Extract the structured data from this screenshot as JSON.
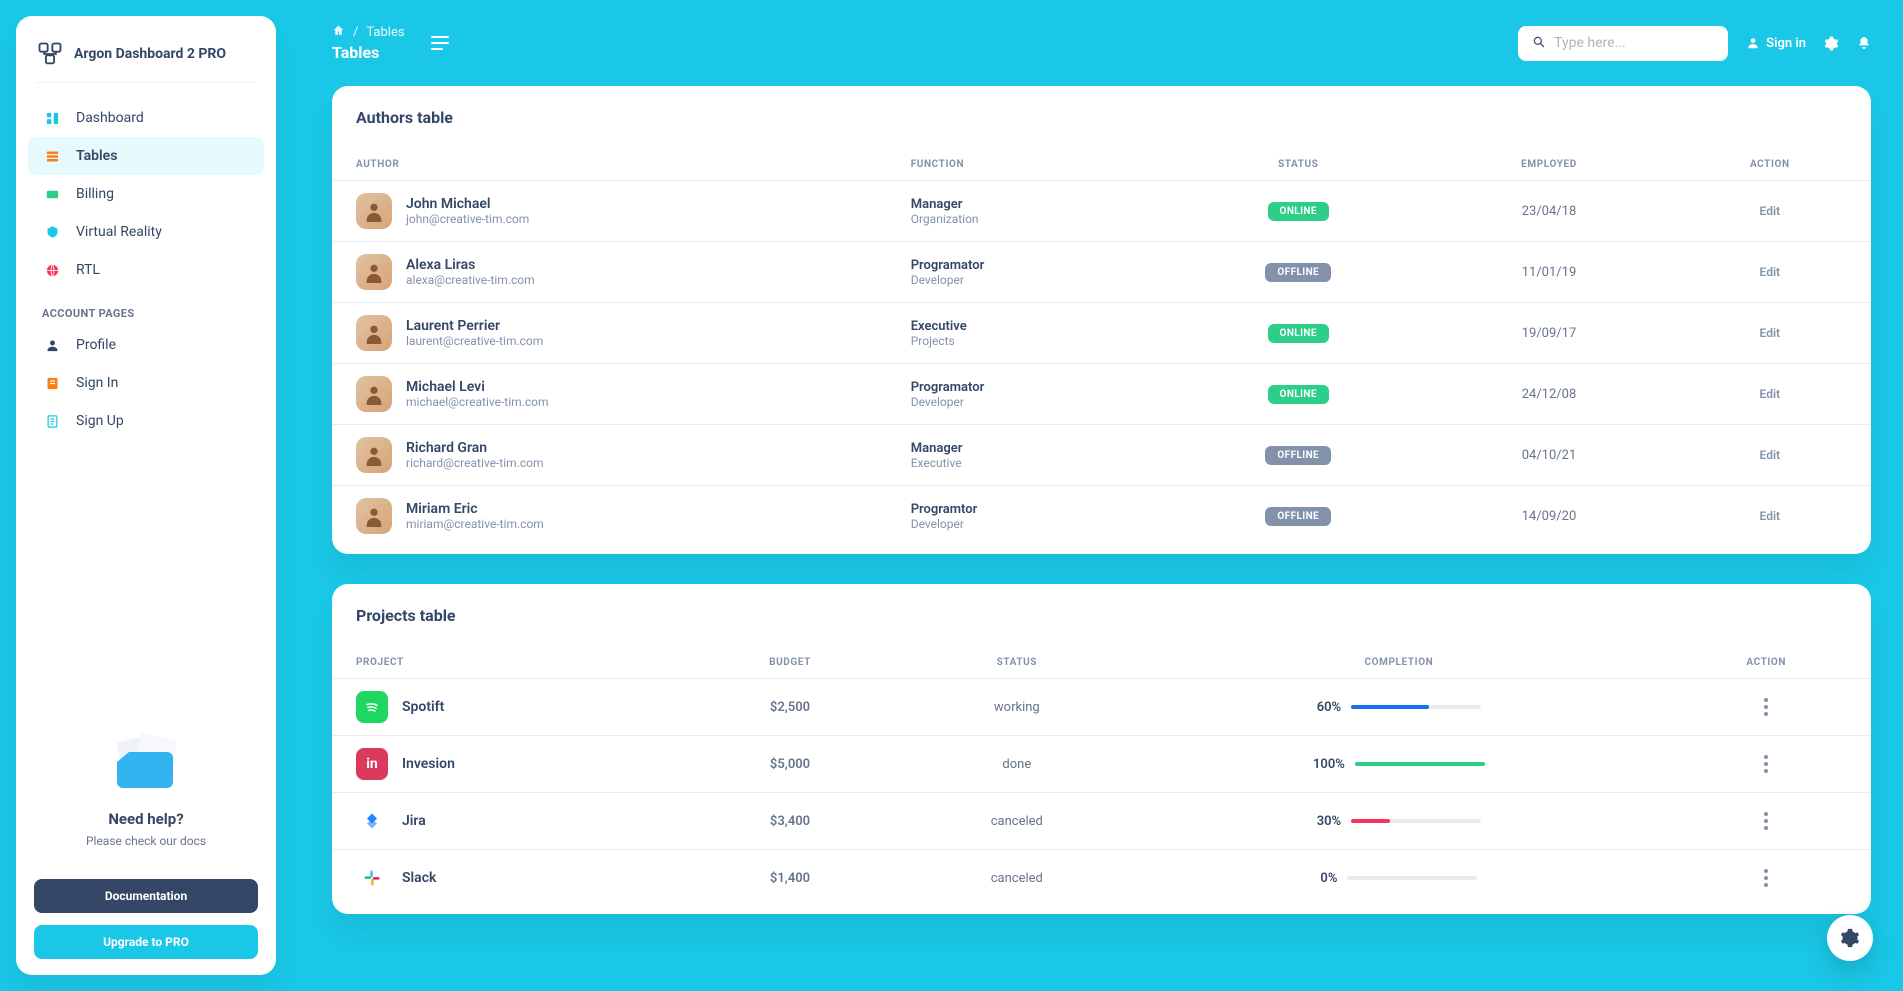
{
  "brand": "Argon Dashboard 2 PRO",
  "sidebar": {
    "items": [
      {
        "label": "Dashboard",
        "color": "#1ac7e6"
      },
      {
        "label": "Tables",
        "color": "#fd7e14",
        "active": true
      },
      {
        "label": "Billing",
        "color": "#2dce89"
      },
      {
        "label": "Virtual Reality",
        "color": "#1ac7e6"
      },
      {
        "label": "RTL",
        "color": "#f5365c"
      }
    ],
    "section": "ACCOUNT PAGES",
    "account": [
      {
        "label": "Profile",
        "color": "#344767"
      },
      {
        "label": "Sign In",
        "color": "#fd7e14"
      },
      {
        "label": "Sign Up",
        "color": "#1ac7e6"
      }
    ],
    "help": {
      "title": "Need help?",
      "sub": "Please check our docs",
      "doc": "Documentation",
      "upgrade": "Upgrade to PRO"
    }
  },
  "topbar": {
    "crumb": "Tables",
    "title": "Tables",
    "placeholder": "Type here...",
    "signin": "Sign in"
  },
  "authors": {
    "title": "Authors table",
    "headers": [
      "AUTHOR",
      "FUNCTION",
      "STATUS",
      "EMPLOYED",
      "ACTION"
    ],
    "edit": "Edit",
    "rows": [
      {
        "name": "John Michael",
        "email": "john@creative-tim.com",
        "role": "Manager",
        "org": "Organization",
        "status": "ONLINE",
        "date": "23/04/18"
      },
      {
        "name": "Alexa Liras",
        "email": "alexa@creative-tim.com",
        "role": "Programator",
        "org": "Developer",
        "status": "OFFLINE",
        "date": "11/01/19"
      },
      {
        "name": "Laurent Perrier",
        "email": "laurent@creative-tim.com",
        "role": "Executive",
        "org": "Projects",
        "status": "ONLINE",
        "date": "19/09/17"
      },
      {
        "name": "Michael Levi",
        "email": "michael@creative-tim.com",
        "role": "Programator",
        "org": "Developer",
        "status": "ONLINE",
        "date": "24/12/08"
      },
      {
        "name": "Richard Gran",
        "email": "richard@creative-tim.com",
        "role": "Manager",
        "org": "Executive",
        "status": "OFFLINE",
        "date": "04/10/21"
      },
      {
        "name": "Miriam Eric",
        "email": "miriam@creative-tim.com",
        "role": "Programtor",
        "org": "Developer",
        "status": "OFFLINE",
        "date": "14/09/20"
      }
    ]
  },
  "projects": {
    "title": "Projects table",
    "headers": [
      "PROJECT",
      "BUDGET",
      "STATUS",
      "COMPLETION",
      "ACTION"
    ],
    "rows": [
      {
        "name": "Spotift",
        "budget": "$2,500",
        "status": "working",
        "pct": 60,
        "color": "#1171ef",
        "logo_bg": "#1ed760",
        "logo_fg": "#fff",
        "glyph": "spotify"
      },
      {
        "name": "Invesion",
        "budget": "$5,000",
        "status": "done",
        "pct": 100,
        "color": "#2dce89",
        "logo_bg": "#dc395f",
        "logo_fg": "#fff",
        "glyph": "in"
      },
      {
        "name": "Jira",
        "budget": "$3,400",
        "status": "canceled",
        "pct": 30,
        "color": "#f5365c",
        "logo_bg": "#fff",
        "logo_fg": "#2684ff",
        "glyph": "jira"
      },
      {
        "name": "Slack",
        "budget": "$1,400",
        "status": "canceled",
        "pct": 0,
        "color": "#2dce89",
        "logo_bg": "#fff",
        "logo_fg": "#611f69",
        "glyph": "slack"
      }
    ]
  }
}
